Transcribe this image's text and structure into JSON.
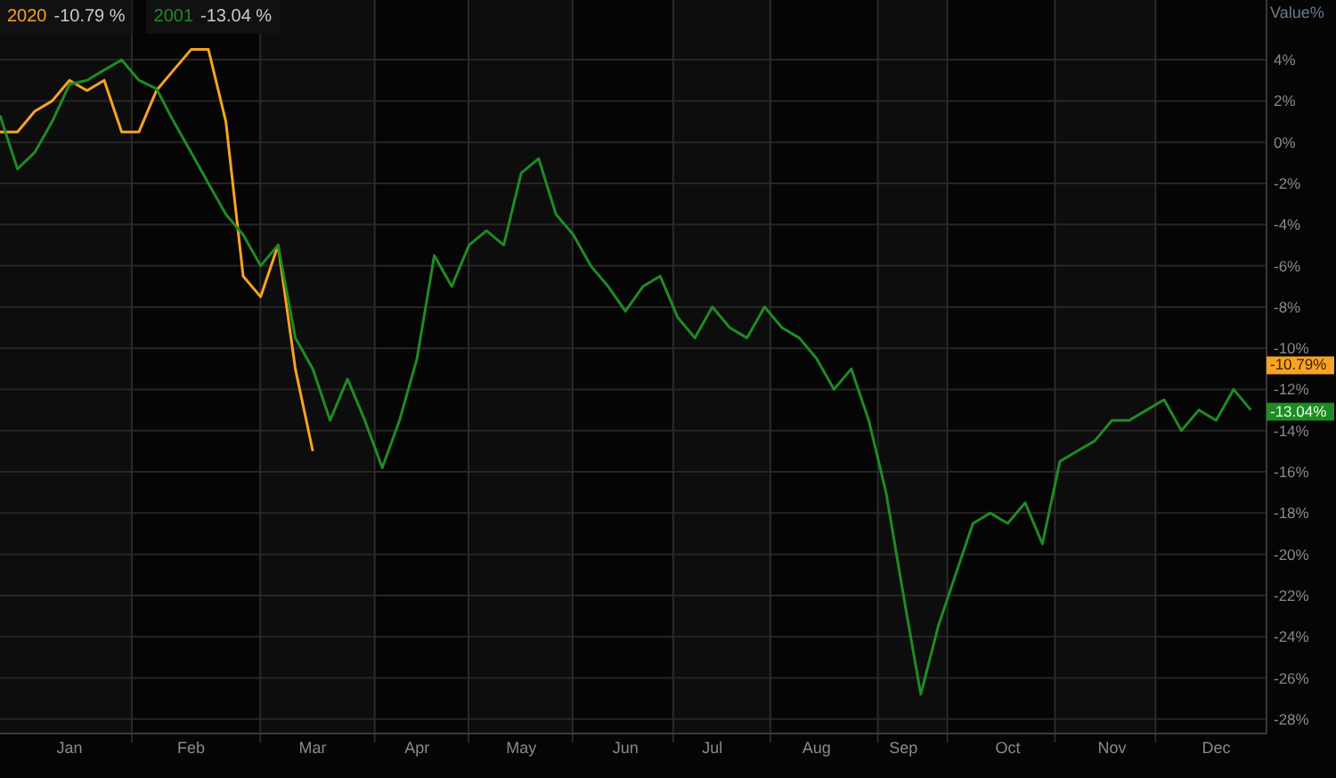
{
  "legend": [
    {
      "value": "-10.79 %"
    },
    {
      "value": "-13.04 %"
    }
  ],
  "chart_data": {
    "type": "line",
    "grid": true,
    "ylabel": "Value%",
    "ylim": [
      -28.7,
      6.9
    ],
    "categories": [
      null,
      null,
      null,
      null,
      "Jan",
      null,
      null,
      null,
      null,
      null,
      null,
      "Feb",
      null,
      null,
      null,
      null,
      null,
      null,
      "Mar",
      null,
      null,
      null,
      null,
      null,
      "Apr",
      null,
      null,
      null,
      null,
      null,
      "May",
      null,
      null,
      null,
      null,
      null,
      "Jun",
      null,
      null,
      null,
      null,
      "Jul",
      null,
      null,
      null,
      null,
      null,
      "Aug",
      null,
      null,
      null,
      null,
      "Sep",
      null,
      null,
      null,
      null,
      null,
      "Oct",
      null,
      null,
      null,
      null,
      null,
      "Nov",
      null,
      null,
      null,
      null,
      null,
      "Dec",
      null,
      null
    ],
    "yticks": [
      {
        "value": 4,
        "label": "4%"
      },
      {
        "value": 2,
        "label": "2%"
      },
      {
        "value": 0,
        "label": "0%"
      },
      {
        "value": -2,
        "label": "-2%"
      },
      {
        "value": -4,
        "label": "-4%"
      },
      {
        "value": -6,
        "label": "-6%"
      },
      {
        "value": -8,
        "label": "-8%"
      },
      {
        "value": -10,
        "label": "-10%"
      },
      {
        "value": -12,
        "label": "-12%"
      },
      {
        "value": -14,
        "label": "-14%"
      },
      {
        "value": -16,
        "label": "-16%"
      },
      {
        "value": -18,
        "label": "-18%"
      },
      {
        "value": -20,
        "label": "-20%"
      },
      {
        "value": -22,
        "label": "-22%"
      },
      {
        "value": -24,
        "label": "-24%"
      },
      {
        "value": -26,
        "label": "-26%"
      },
      {
        "value": -28,
        "label": "-28%"
      }
    ],
    "series": [
      {
        "name": "2020",
        "color": "#f7a325",
        "values": [
          0.5,
          0.5,
          1.5,
          2.0,
          3.0,
          2.5,
          3.0,
          0.5,
          0.5,
          2.5,
          3.5,
          4.5,
          4.5,
          1.0,
          -6.5,
          -7.5,
          -5.0,
          -11.0,
          -15.0,
          null,
          null,
          null,
          null,
          null,
          null,
          null,
          null,
          null,
          null,
          null,
          null,
          null,
          null,
          null,
          null,
          null,
          null,
          null,
          null,
          null,
          null,
          null,
          null,
          null,
          null,
          null,
          null,
          null,
          null,
          null,
          null,
          null,
          null,
          null,
          null,
          null,
          null,
          null,
          null,
          null,
          null,
          null,
          null,
          null,
          null,
          null,
          null,
          null,
          null,
          null,
          null,
          null,
          null
        ]
      },
      {
        "name": "2001",
        "color": "#1f8b24",
        "values": [
          1.3,
          -1.3,
          -0.5,
          1.0,
          2.8,
          3.0,
          3.5,
          4.0,
          3.0,
          2.6,
          1.0,
          -0.5,
          -2.0,
          -3.5,
          -4.5,
          -6.0,
          -5.0,
          -9.5,
          -11.0,
          -13.5,
          -11.5,
          -13.5,
          -15.8,
          -13.5,
          -10.5,
          -5.5,
          -7.0,
          -5.0,
          -4.3,
          -5.0,
          -1.5,
          -0.8,
          -3.5,
          -4.5,
          -6.0,
          -7.0,
          -8.2,
          -7.0,
          -6.5,
          -8.5,
          -9.5,
          -8.0,
          -9.0,
          -9.5,
          -8.0,
          -9.0,
          -9.5,
          -10.5,
          -12.0,
          -11.0,
          -13.5,
          -17.0,
          -22.0,
          -26.8,
          -23.5,
          -21.0,
          -18.5,
          -18.0,
          -18.5,
          -17.5,
          -19.5,
          -15.5,
          -15.0,
          -14.5,
          -13.5,
          -13.5,
          -13.0,
          -12.5,
          -14.0,
          -13.0,
          -13.5,
          -12.0,
          -13.0
        ]
      }
    ],
    "annotations": [
      "-10.79%",
      "-13.04%"
    ]
  }
}
